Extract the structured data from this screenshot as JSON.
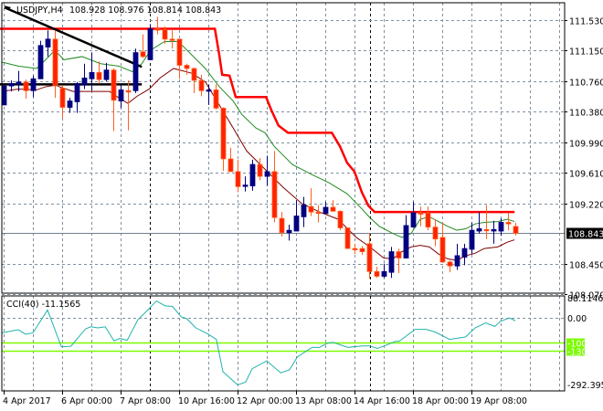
{
  "header": {
    "symbol": "USDJPY,H4",
    "ohlc": "108.928 108.976 108.814 108.843"
  },
  "colors": {
    "bull": "#000080",
    "bear": "#ff2200",
    "bear_border": "#ff6020",
    "resistance": "#ff0000",
    "ma_fast": "#228b22",
    "ma_slow": "#800000",
    "cci": "#20b2aa",
    "level": "#7cfc00",
    "trend": "#000000"
  },
  "chart_data": [
    {
      "type": "candlestick",
      "title": "USDJPY,H4",
      "ylim": [
        108.07,
        111.53
      ],
      "y_ticks": [
        "111.530",
        "111.150",
        "110.760",
        "110.380",
        "109.990",
        "109.610",
        "109.220",
        "108.450",
        "108.070"
      ],
      "current_price": "108.843",
      "current_price_value": 108.843,
      "x_labels": [
        {
          "index": 0,
          "label": "4 Apr 2017"
        },
        {
          "index": 8,
          "label": "6 Apr 00:00"
        },
        {
          "index": 16,
          "label": "7 Apr 08:00"
        },
        {
          "index": 24,
          "label": "10 Apr 16:00"
        },
        {
          "index": 32,
          "label": "12 Apr 00:00"
        },
        {
          "index": 40,
          "label": "13 Apr 08:00"
        },
        {
          "index": 48,
          "label": "14 Apr 16:00"
        },
        {
          "index": 56,
          "label": "18 Apr 00:00"
        },
        {
          "index": 64,
          "label": "19 Apr 08:00"
        }
      ],
      "period_separators": [
        20,
        50.1
      ],
      "candles_ohlc": [
        [
          110.46,
          110.7,
          110.46,
          110.7
        ],
        [
          110.7,
          110.77,
          110.63,
          110.73
        ],
        [
          110.72,
          110.89,
          110.63,
          110.75
        ],
        [
          110.75,
          110.78,
          110.54,
          110.64
        ],
        [
          110.64,
          110.83,
          110.56,
          110.79
        ],
        [
          110.79,
          111.27,
          110.79,
          111.21
        ],
        [
          111.19,
          111.4,
          111.07,
          111.29
        ],
        [
          111.29,
          111.4,
          110.55,
          110.7
        ],
        [
          110.67,
          110.71,
          110.29,
          110.43
        ],
        [
          110.43,
          110.55,
          110.36,
          110.51
        ],
        [
          110.5,
          110.75,
          110.36,
          110.73
        ],
        [
          110.71,
          110.98,
          110.66,
          110.8
        ],
        [
          110.79,
          111.12,
          110.64,
          110.87
        ],
        [
          110.87,
          111.01,
          110.73,
          110.78
        ],
        [
          110.78,
          110.99,
          110.76,
          110.9
        ],
        [
          110.9,
          110.92,
          110.13,
          110.52
        ],
        [
          110.51,
          110.71,
          110.42,
          110.65
        ],
        [
          110.64,
          110.77,
          110.14,
          110.63
        ],
        [
          110.64,
          111.17,
          110.61,
          111.12
        ],
        [
          111.13,
          111.35,
          111.05,
          111.07
        ],
        [
          111.03,
          111.48,
          111.03,
          111.42
        ],
        [
          111.42,
          111.57,
          111.35,
          111.41
        ],
        [
          111.41,
          111.45,
          111.23,
          111.29
        ],
        [
          111.29,
          111.4,
          111.17,
          111.28
        ],
        [
          111.29,
          111.29,
          110.79,
          110.96
        ],
        [
          110.96,
          110.98,
          110.84,
          110.92
        ],
        [
          110.92,
          110.93,
          110.61,
          110.77
        ],
        [
          110.77,
          110.84,
          110.57,
          110.64
        ],
        [
          110.64,
          110.72,
          110.46,
          110.65
        ],
        [
          110.65,
          110.72,
          110.4,
          110.42
        ],
        [
          110.42,
          110.43,
          109.63,
          109.78
        ],
        [
          109.78,
          109.92,
          109.62,
          109.62
        ],
        [
          109.62,
          109.77,
          109.36,
          109.43
        ],
        [
          109.44,
          109.56,
          109.37,
          109.45
        ],
        [
          109.44,
          109.77,
          109.38,
          109.71
        ],
        [
          109.71,
          109.79,
          109.51,
          109.56
        ],
        [
          109.56,
          109.82,
          109.44,
          109.62
        ],
        [
          109.62,
          109.88,
          108.98,
          109.04
        ],
        [
          109.03,
          109.11,
          108.8,
          108.85
        ],
        [
          108.85,
          108.95,
          108.75,
          108.88
        ],
        [
          108.87,
          109.26,
          108.87,
          109.06
        ],
        [
          109.05,
          109.3,
          108.92,
          109.2
        ],
        [
          109.18,
          109.41,
          109.06,
          109.11
        ],
        [
          109.11,
          109.2,
          108.98,
          109.1
        ],
        [
          109.09,
          109.24,
          109.09,
          109.17
        ],
        [
          109.17,
          109.26,
          109.12,
          109.12
        ],
        [
          109.12,
          109.13,
          108.88,
          108.91
        ],
        [
          108.91,
          108.91,
          108.65,
          108.65
        ],
        [
          108.65,
          108.71,
          108.58,
          108.64
        ],
        [
          108.65,
          108.68,
          108.57,
          108.61
        ],
        [
          108.71,
          108.84,
          108.27,
          108.36
        ],
        [
          108.36,
          108.42,
          108.28,
          108.3
        ],
        [
          108.3,
          108.46,
          108.28,
          108.36
        ],
        [
          108.35,
          108.67,
          108.28,
          108.61
        ],
        [
          108.61,
          108.65,
          108.34,
          108.53
        ],
        [
          108.53,
          109.07,
          108.53,
          108.94
        ],
        [
          108.92,
          109.24,
          108.92,
          109.1
        ],
        [
          109.1,
          109.18,
          108.93,
          109.09
        ],
        [
          109.1,
          109.18,
          108.88,
          108.92
        ],
        [
          108.92,
          109.02,
          108.68,
          108.77
        ],
        [
          108.79,
          108.98,
          108.48,
          108.48
        ],
        [
          108.48,
          108.5,
          108.35,
          108.43
        ],
        [
          108.43,
          108.71,
          108.38,
          108.56
        ],
        [
          108.54,
          108.71,
          108.44,
          108.65
        ],
        [
          108.64,
          108.98,
          108.58,
          108.88
        ],
        [
          108.87,
          109.11,
          108.84,
          108.9
        ],
        [
          108.89,
          109.2,
          108.77,
          108.88
        ],
        [
          108.87,
          109.0,
          108.71,
          108.89
        ],
        [
          108.87,
          109.03,
          108.81,
          108.98
        ],
        [
          108.98,
          109.1,
          108.88,
          108.96
        ],
        [
          108.928,
          108.976,
          108.814,
          108.843
        ]
      ],
      "resistance_line": [
        [
          -0.5,
          111.42
        ],
        [
          28.9,
          111.42
        ],
        [
          29.5,
          111.09
        ],
        [
          29.9,
          110.84
        ],
        [
          30.9,
          110.83
        ],
        [
          31.75,
          110.56
        ],
        [
          35.9,
          110.56
        ],
        [
          36.6,
          110.4
        ],
        [
          37.6,
          110.2
        ],
        [
          38.9,
          110.11
        ],
        [
          44.9,
          110.11
        ],
        [
          46,
          109.94
        ],
        [
          47,
          109.73
        ],
        [
          48,
          109.62
        ],
        [
          49,
          109.36
        ],
        [
          49.9,
          109.19
        ],
        [
          50.75,
          109.11
        ],
        [
          69.9,
          109.11
        ]
      ],
      "trend_line": [
        [
          0.1,
          111.69
        ],
        [
          18.9,
          110.94
        ]
      ],
      "horizontal_line": [
        [
          -0.5,
          110.72
        ],
        [
          18.9,
          110.72
        ]
      ],
      "ma_fast": [
        [
          -0.25,
          111.0
        ],
        [
          2,
          110.95
        ],
        [
          4.5,
          110.92
        ],
        [
          5.75,
          111.03
        ],
        [
          7,
          111.15
        ],
        [
          8.25,
          111.03
        ],
        [
          10.75,
          111.07
        ],
        [
          13.25,
          110.98
        ],
        [
          15.75,
          110.95
        ],
        [
          17.6,
          110.88
        ],
        [
          18.9,
          110.98
        ],
        [
          20.1,
          111.15
        ],
        [
          22,
          111.26
        ],
        [
          23.9,
          111.26
        ],
        [
          25.75,
          111.09
        ],
        [
          27.6,
          110.92
        ],
        [
          29.5,
          110.69
        ],
        [
          31.4,
          110.51
        ],
        [
          32.6,
          110.34
        ],
        [
          34.5,
          110.17
        ],
        [
          35.75,
          110.11
        ],
        [
          37,
          109.94
        ],
        [
          39.5,
          109.71
        ],
        [
          42,
          109.59
        ],
        [
          44.5,
          109.48
        ],
        [
          47,
          109.34
        ],
        [
          48.9,
          109.16
        ],
        [
          50.1,
          109.04
        ],
        [
          51.4,
          108.93
        ],
        [
          53.25,
          108.84
        ],
        [
          54.5,
          108.79
        ],
        [
          55.75,
          108.84
        ],
        [
          57,
          109.02
        ],
        [
          58.25,
          109.05
        ],
        [
          59.5,
          108.99
        ],
        [
          60.75,
          108.93
        ],
        [
          62,
          108.88
        ],
        [
          63.25,
          108.9
        ],
        [
          64.5,
          108.96
        ],
        [
          65.75,
          108.98
        ],
        [
          67.6,
          108.99
        ],
        [
          68.9,
          109.02
        ],
        [
          69.9,
          108.99
        ]
      ],
      "ma_slow": [
        [
          -0.25,
          110.63
        ],
        [
          2,
          110.66
        ],
        [
          4.5,
          110.65
        ],
        [
          5.75,
          110.69
        ],
        [
          7,
          110.71
        ],
        [
          9.5,
          110.63
        ],
        [
          12,
          110.63
        ],
        [
          14.5,
          110.63
        ],
        [
          15.75,
          110.55
        ],
        [
          17,
          110.48
        ],
        [
          18.25,
          110.57
        ],
        [
          19.9,
          110.66
        ],
        [
          21.4,
          110.8
        ],
        [
          23.25,
          110.92
        ],
        [
          25.75,
          110.86
        ],
        [
          27.6,
          110.75
        ],
        [
          29.5,
          110.46
        ],
        [
          31.4,
          110.17
        ],
        [
          33.25,
          109.88
        ],
        [
          35.75,
          109.65
        ],
        [
          38.25,
          109.42
        ],
        [
          40.75,
          109.22
        ],
        [
          43.25,
          109.11
        ],
        [
          45.75,
          109.02
        ],
        [
          48.25,
          108.79
        ],
        [
          50.1,
          108.67
        ],
        [
          52,
          108.53
        ],
        [
          53.25,
          108.52
        ],
        [
          54.5,
          108.61
        ],
        [
          55.75,
          108.67
        ],
        [
          57,
          108.69
        ],
        [
          58.25,
          108.67
        ],
        [
          59.5,
          108.58
        ],
        [
          60.75,
          108.52
        ],
        [
          62,
          108.5
        ],
        [
          63.25,
          108.56
        ],
        [
          64.5,
          108.59
        ],
        [
          65.75,
          108.65
        ],
        [
          67.6,
          108.67
        ],
        [
          68.9,
          108.73
        ],
        [
          69.9,
          108.76
        ]
      ]
    },
    {
      "type": "line",
      "title": "CCI(40) -11.1565",
      "ylim": [
        -292.395,
        88.1146
      ],
      "y_ticks": [
        "88.1146",
        "0.00",
        "-292.395"
      ],
      "levels": [
        {
          "value": -100,
          "label": "-100"
        },
        {
          "value": -130,
          "label": "-130"
        }
      ],
      "series": [
        [
          -0.25,
          -60
        ],
        [
          2,
          -47.5
        ],
        [
          3,
          -65.5
        ],
        [
          4,
          -60
        ],
        [
          6,
          31.7
        ],
        [
          7.9,
          -116
        ],
        [
          9.2,
          -113.5
        ],
        [
          11.2,
          -44
        ],
        [
          11.9,
          -35.5
        ],
        [
          12.9,
          -40
        ],
        [
          13.9,
          -35.5
        ],
        [
          15.1,
          -92
        ],
        [
          15.9,
          -82
        ],
        [
          16.9,
          -89.5
        ],
        [
          18.35,
          -8
        ],
        [
          19.8,
          34
        ],
        [
          20.9,
          67.7
        ],
        [
          22.1,
          48.5
        ],
        [
          23.1,
          46
        ],
        [
          24.3,
          4
        ],
        [
          25,
          -2
        ],
        [
          26.3,
          -40
        ],
        [
          28,
          -65.5
        ],
        [
          29.1,
          -86
        ],
        [
          30,
          -215.5
        ],
        [
          32,
          -268
        ],
        [
          33.1,
          -257.5
        ],
        [
          34,
          -203.5
        ],
        [
          36,
          -172
        ],
        [
          37.9,
          -220
        ],
        [
          39.1,
          -208
        ],
        [
          40.2,
          -155.5
        ],
        [
          42.2,
          -118
        ],
        [
          43.2,
          -118
        ],
        [
          44.4,
          -100
        ],
        [
          45.1,
          -98
        ],
        [
          47.1,
          -118
        ],
        [
          49.1,
          -112
        ],
        [
          50.1,
          -112
        ],
        [
          51.1,
          -122
        ],
        [
          52.1,
          -112
        ],
        [
          53.6,
          -94
        ],
        [
          54.1,
          -94
        ],
        [
          56.3,
          -46
        ],
        [
          57.8,
          -46
        ],
        [
          59,
          -56
        ],
        [
          61,
          -86
        ],
        [
          63.2,
          -76
        ],
        [
          64.5,
          -40
        ],
        [
          65.96,
          -20
        ],
        [
          67.2,
          -34
        ],
        [
          67.95,
          -14
        ],
        [
          69.2,
          0
        ],
        [
          70,
          -11.16
        ]
      ]
    }
  ]
}
